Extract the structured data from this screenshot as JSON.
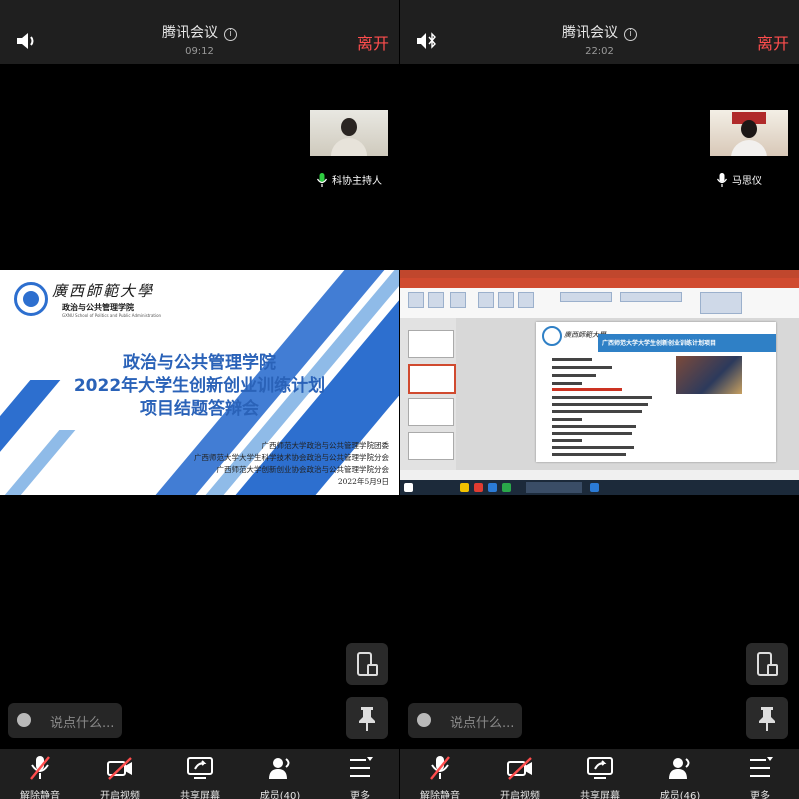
{
  "meeting_app": "腾讯会议",
  "left": {
    "title": "腾讯会议",
    "time": "09:12",
    "leave_label": "离开",
    "participant_name": "科协主持人",
    "slide": {
      "university": "廣西師範大學",
      "school_cn": "政治与公共管理学院",
      "school_en": "GXNU School of Politics and Public Administration",
      "title_line1": "政治与公共管理学院",
      "title_line2": "2022年大学生创新创业训练计划",
      "title_line3": "项目结题答辩会",
      "org1": "广西师范大学政治与公共管理学院团委",
      "org2": "广西师范大学大学生科学技术协会政治与公共管理学院分会",
      "org3": "广西师范大学创新创业协会政治与公共管理学院分会",
      "date": "2022年5月9日"
    },
    "chat_placeholder": "说点什么...",
    "toolbar": [
      {
        "label": "解除静音",
        "icon": "mic-muted-icon"
      },
      {
        "label": "开启视频",
        "icon": "camera-off-icon"
      },
      {
        "label": "共享屏幕",
        "icon": "share-screen-icon"
      },
      {
        "label": "成员(40)",
        "icon": "members-icon"
      },
      {
        "label": "更多",
        "icon": "more-icon"
      }
    ]
  },
  "right": {
    "title": "腾讯会议",
    "time": "22:02",
    "leave_label": "离开",
    "participant_name": "马思仪",
    "ppt": {
      "slide_header": "广西师范大学大学生创新创业训练计划项目",
      "university": "廣西師範大學"
    },
    "chat_placeholder": "说点什么...",
    "toolbar": [
      {
        "label": "解除静音",
        "icon": "mic-muted-icon"
      },
      {
        "label": "开启视频",
        "icon": "camera-off-icon"
      },
      {
        "label": "共享屏幕",
        "icon": "share-screen-icon"
      },
      {
        "label": "成员(46)",
        "icon": "members-icon"
      },
      {
        "label": "更多",
        "icon": "more-icon"
      }
    ]
  },
  "colors": {
    "leave": "#ff4d4d",
    "slide_blue": "#2d6fcf",
    "ppt_red": "#d04a2f",
    "background": "#000000"
  }
}
